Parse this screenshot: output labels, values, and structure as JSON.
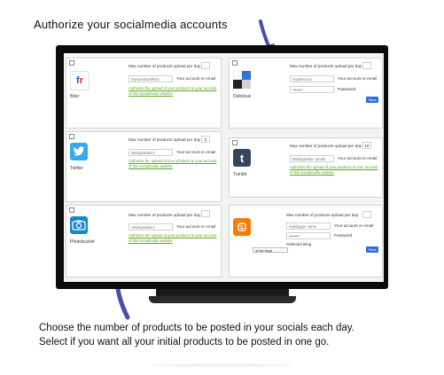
{
  "captions": {
    "top": "Authorize your socialmedia accounts",
    "bottom_line1": "Choose the number of products to be posted in your socials each day.",
    "bottom_line2": "Select if you want all your initial products to be posted in one go."
  },
  "common": {
    "max_label": "Max number of products upload per day",
    "account_label": "Your account or email",
    "password_label": "Password",
    "authorize_link": "Authorize the upload of your products to your account of this socialmedia website",
    "save_label": "Save",
    "checkbox_mark": "⊠"
  },
  "panels": {
    "flickr": {
      "name": "flickr",
      "account_value": "mynametoreflickr",
      "max_value": ""
    },
    "delicious": {
      "name": "Delicious",
      "account_value": "mydelicious",
      "password_value": "••••••••",
      "max_value": ""
    },
    "twitter": {
      "name": "Twitter",
      "account_value": "WebbyMaker1",
      "max_value": "2"
    },
    "tumblr": {
      "name": "Tumblr",
      "account_value": "WebbyMaker tumblr",
      "max_value": "10"
    },
    "photobucket": {
      "name": "Photobucket",
      "account_value": "WebbyMaker1",
      "max_value": ""
    },
    "blogger": {
      "name": "Blogger",
      "account_value": "myblogger name",
      "password_value": "••••••••",
      "max_value": "",
      "blog_label": "Selected Blog",
      "select_value": "all the blogs"
    }
  },
  "colors": {
    "flickr_pink": "#ff0084",
    "flickr_blue": "#0063dc",
    "twitter": "#33aaf0",
    "tumblr": "#35465c",
    "photobucket": "#1b87c9",
    "blogger": "#f57d00",
    "arrow": "#4b4da8",
    "link_green": "#5aa61e",
    "save_blue": "#2f6ed8"
  }
}
